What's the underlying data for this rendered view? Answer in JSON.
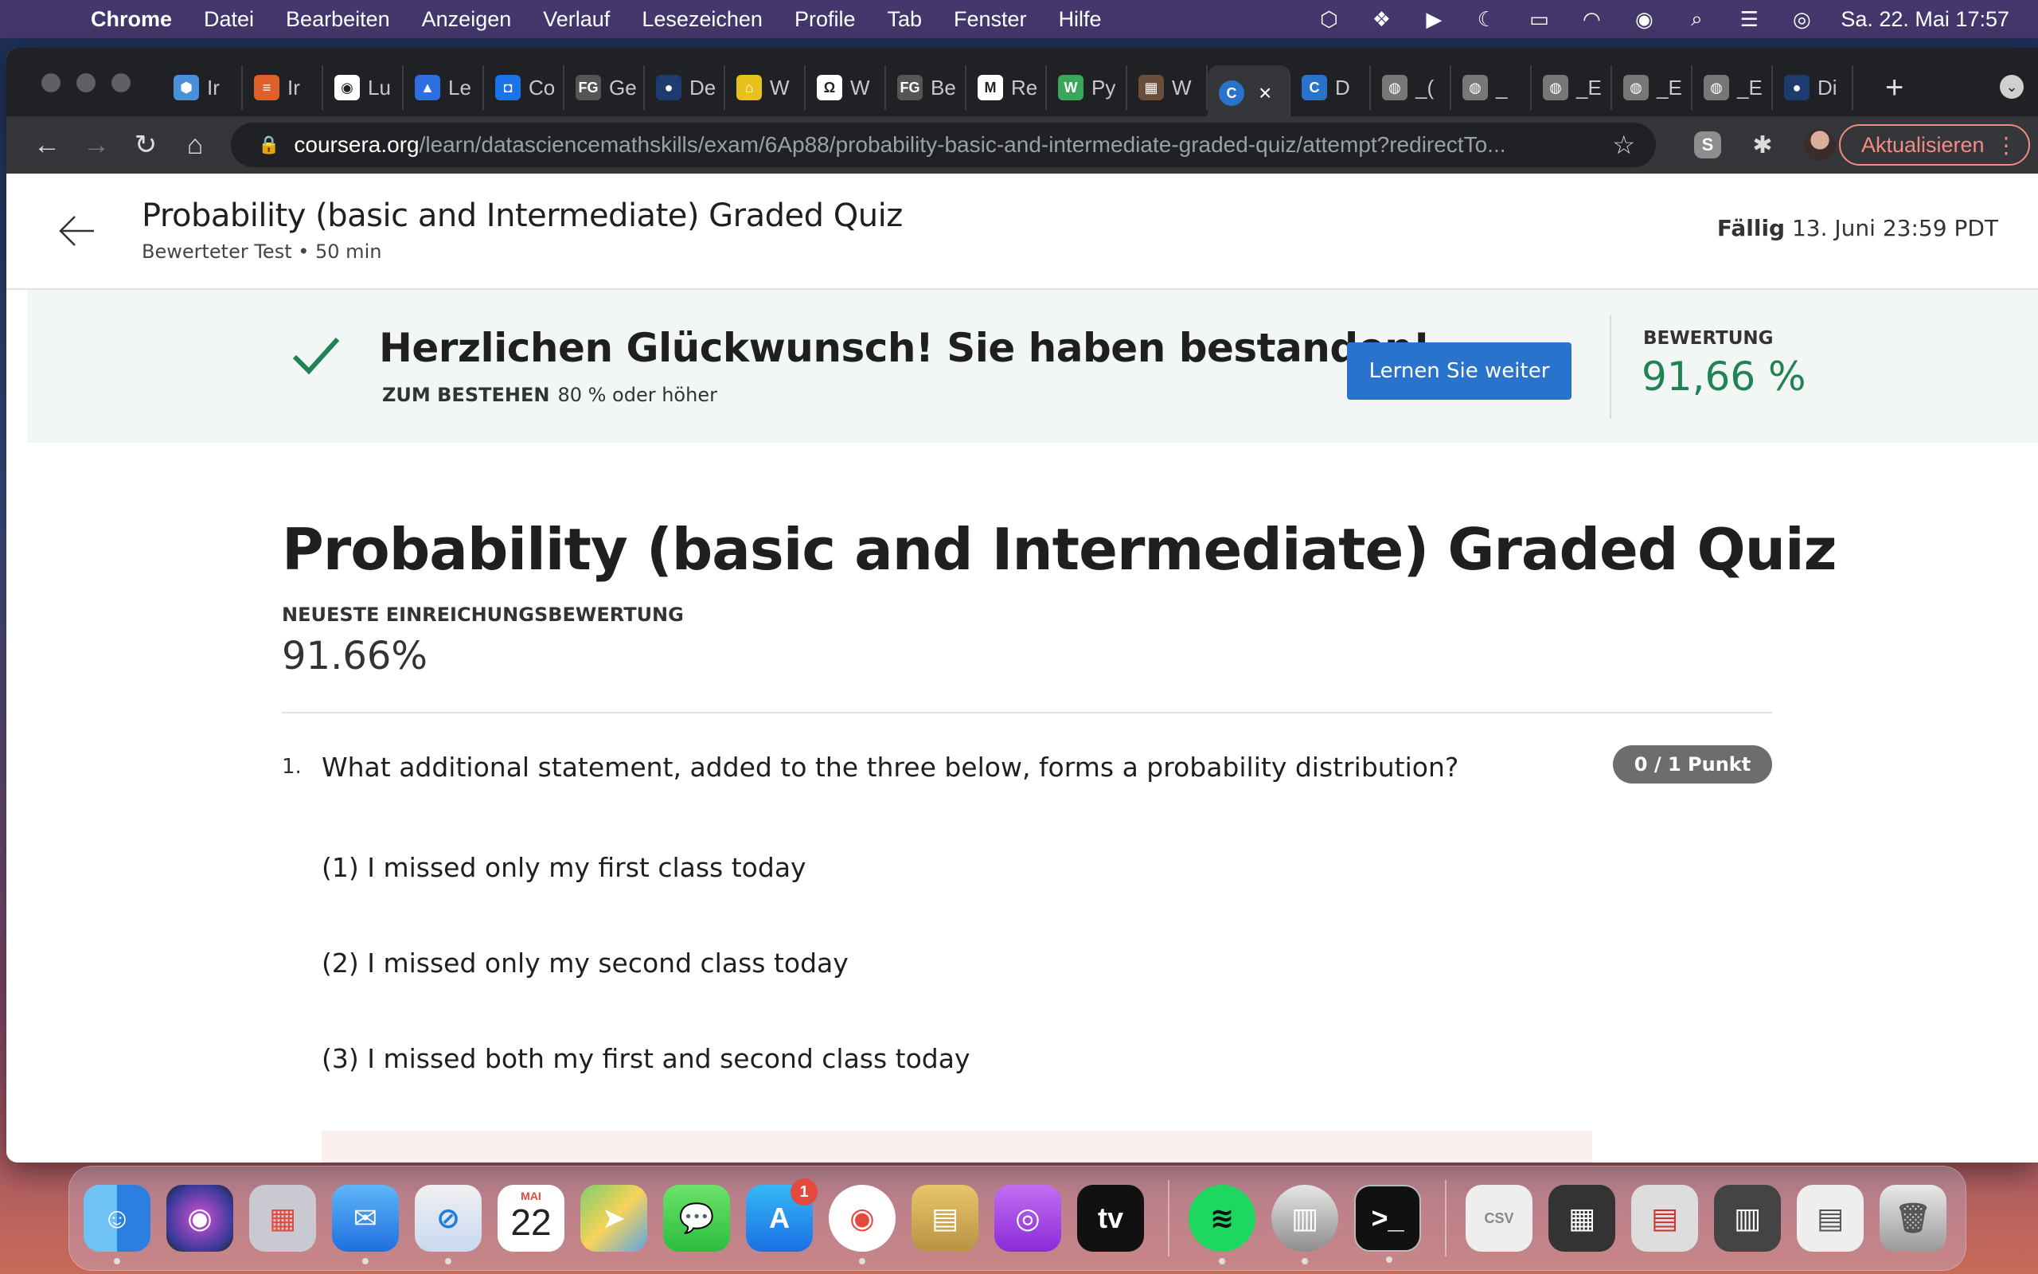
{
  "menubar": {
    "app_name": "Chrome",
    "items": [
      "Datei",
      "Bearbeiten",
      "Anzeigen",
      "Verlauf",
      "Lesezeichen",
      "Profile",
      "Tab",
      "Fenster",
      "Hilfe"
    ],
    "clock": "Sa. 22. Mai  17:57"
  },
  "browser": {
    "tabs": [
      {
        "label": "Ir",
        "fav_color": "#4a90d9",
        "fav_char": "⬢"
      },
      {
        "label": "Ir",
        "fav_color": "#e0602a",
        "fav_char": "≡"
      },
      {
        "label": "Lu",
        "fav_color": "#ffffff",
        "fav_char": "◉"
      },
      {
        "label": "Le",
        "fav_color": "#2d6fe0",
        "fav_char": "▲"
      },
      {
        "label": "Co",
        "fav_color": "#1a73e8",
        "fav_char": "◘"
      },
      {
        "label": "Ge",
        "fav_color": "#555555",
        "fav_char": "FG"
      },
      {
        "label": "De",
        "fav_color": "#1d3b6e",
        "fav_char": "●"
      },
      {
        "label": "W",
        "fav_color": "#e6c21a",
        "fav_char": "⌂"
      },
      {
        "label": "W",
        "fav_color": "#ffffff",
        "fav_char": "Ω"
      },
      {
        "label": "Be",
        "fav_color": "#555555",
        "fav_char": "FG"
      },
      {
        "label": "Re",
        "fav_color": "#ffffff",
        "fav_char": "M"
      },
      {
        "label": "Py",
        "fav_color": "#3aa65a",
        "fav_char": "W"
      },
      {
        "label": "W",
        "fav_color": "#6b4e3a",
        "fav_char": "▦"
      }
    ],
    "active_tab": {
      "label": "",
      "fav_char": "C",
      "fav_color": "#2a73cc"
    },
    "tabs_after": [
      {
        "label": "D",
        "fav_color": "#2a73cc",
        "fav_char": "C"
      },
      {
        "label": "_(",
        "fav_color": "#777777",
        "fav_char": "◍"
      },
      {
        "label": "_",
        "fav_color": "#777777",
        "fav_char": "◍"
      },
      {
        "label": "_E",
        "fav_color": "#777777",
        "fav_char": "◍"
      },
      {
        "label": "_E",
        "fav_color": "#777777",
        "fav_char": "◍"
      },
      {
        "label": "_E",
        "fav_color": "#777777",
        "fav_char": "◍"
      },
      {
        "label": "Di",
        "fav_color": "#1d3b6e",
        "fav_char": "●"
      }
    ],
    "url_host": "coursera.org",
    "url_path": "/learn/datasciencemathskills/exam/6Ap88/probability-basic-and-intermediate-graded-quiz/attempt?redirectTo...",
    "update_label": "Aktualisieren"
  },
  "page": {
    "header_title": "Probability (basic and Intermediate) Graded Quiz",
    "header_subtitle": "Bewerteter Test • 50 min",
    "due_label": "Fällig",
    "due_value": " 13. Juni 23:59 PDT",
    "banner": {
      "congrats": "Herzlichen Glückwunsch! Sie haben bestanden!",
      "pass_label": "ZUM BESTEHEN",
      "pass_value": "80 % oder höher",
      "continue_label": "Lernen Sie weiter",
      "grade_label": "BEWERTUNG",
      "grade_value": "91,66 %"
    },
    "quiz_title": "Probability (basic and Intermediate) Graded Quiz",
    "latest_label": "NEUESTE EINREICHUNGSBEWERTUNG",
    "latest_value": "91.66%",
    "question": {
      "number": "1.",
      "text": "What additional statement, added to the three below, forms a probability distribution?",
      "points": "0 / 1 Punkt",
      "statements": [
        "(1) I missed only my first class today",
        "(2) I missed only my second class today",
        "(3) I missed both my first and second class today"
      ]
    }
  },
  "dock": {
    "calendar_month": "MAI",
    "calendar_day": "22",
    "appstore_badge": "1"
  },
  "colors": {
    "accent_blue": "#2a73cc",
    "success_green": "#1f8354",
    "banner_bg": "#f2f6f5",
    "update_red": "#f28b82"
  }
}
